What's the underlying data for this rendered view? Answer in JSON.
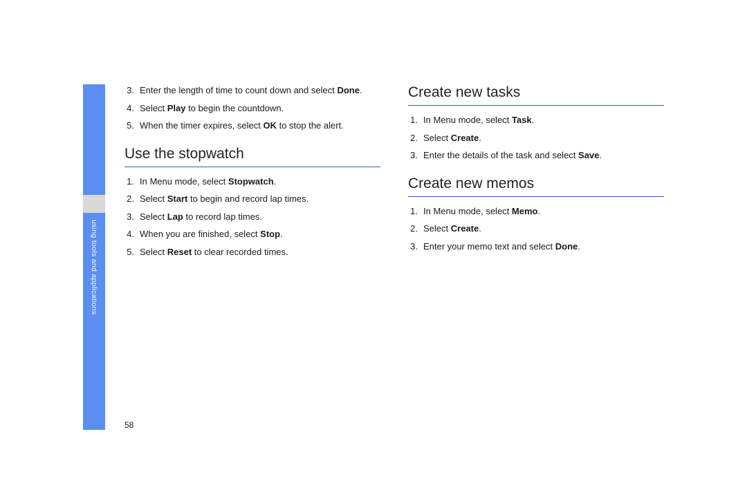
{
  "side_tab_label": "using tools and applications",
  "page_number": "58",
  "left_column": {
    "continuation_steps": [
      {
        "num": "3.",
        "parts": [
          "Enter the length of time to count down and select ",
          "Done",
          "."
        ]
      },
      {
        "num": "4.",
        "parts": [
          "Select ",
          "Play",
          " to begin the countdown."
        ]
      },
      {
        "num": "5.",
        "parts": [
          "When the timer expires, select ",
          "OK",
          " to stop the alert."
        ]
      }
    ],
    "section2_title": "Use the stopwatch",
    "section2_steps": [
      {
        "num": "1.",
        "parts": [
          "In Menu mode, select ",
          "Stopwatch",
          "."
        ]
      },
      {
        "num": "2.",
        "parts": [
          "Select ",
          "Start",
          " to begin and record lap times."
        ]
      },
      {
        "num": "3.",
        "parts": [
          "Select ",
          "Lap",
          " to record lap times."
        ]
      },
      {
        "num": "4.",
        "parts": [
          "When you are finished, select ",
          "Stop",
          "."
        ]
      },
      {
        "num": "5.",
        "parts": [
          "Select ",
          "Reset",
          " to clear recorded times."
        ]
      }
    ]
  },
  "right_column": {
    "section1_title": "Create new tasks",
    "section1_steps": [
      {
        "num": "1.",
        "parts": [
          "In Menu mode, select ",
          "Task",
          "."
        ]
      },
      {
        "num": "2.",
        "parts": [
          "Select ",
          "Create",
          "."
        ]
      },
      {
        "num": "3.",
        "parts": [
          "Enter the details of the task and select ",
          "Save",
          "."
        ]
      }
    ],
    "section2_title": "Create new memos",
    "section2_steps": [
      {
        "num": "1.",
        "parts": [
          "In Menu mode, select ",
          "Memo",
          "."
        ]
      },
      {
        "num": "2.",
        "parts": [
          "Select ",
          "Create",
          "."
        ]
      },
      {
        "num": "3.",
        "parts": [
          "Enter your memo text and select ",
          "Done",
          "."
        ]
      }
    ]
  }
}
